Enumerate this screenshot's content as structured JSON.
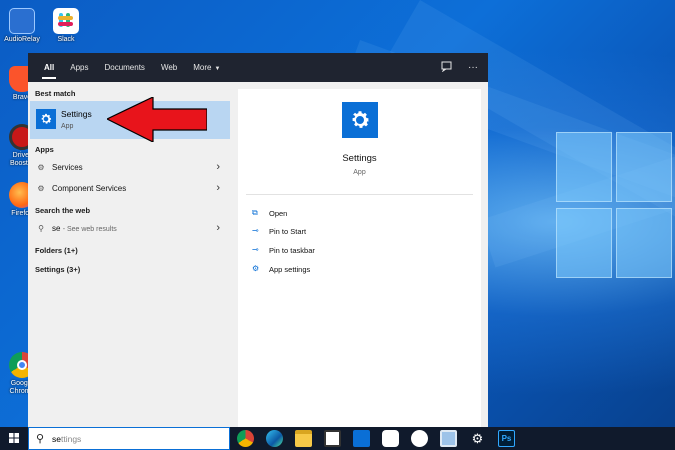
{
  "desktop": {
    "icons": [
      {
        "label": "AudioRelay"
      },
      {
        "label": "Slack"
      },
      {
        "label": "Brave"
      },
      {
        "label": "Driver Booster"
      },
      {
        "label": "Firefox"
      },
      {
        "label": "Google Chrome"
      }
    ]
  },
  "start_menu": {
    "tabs": [
      {
        "label": "All",
        "active": true
      },
      {
        "label": "Apps"
      },
      {
        "label": "Documents"
      },
      {
        "label": "Web"
      },
      {
        "label": "More"
      }
    ],
    "best_match_label": "Best match",
    "best_match": {
      "title": "Settings",
      "subtitle": "App"
    },
    "apps_label": "Apps",
    "apps": [
      {
        "label": "Services"
      },
      {
        "label": "Component Services"
      }
    ],
    "web_label": "Search the web",
    "web_result": {
      "query": "se",
      "suffix": "- See web results"
    },
    "folders_label": "Folders (1+)",
    "settings_label": "Settings (3+)",
    "detail": {
      "title": "Settings",
      "subtitle": "App",
      "actions": [
        {
          "label": "Open",
          "icon": "open-icon"
        },
        {
          "label": "Pin to Start",
          "icon": "pin-icon"
        },
        {
          "label": "Pin to taskbar",
          "icon": "pin-icon"
        },
        {
          "label": "App settings",
          "icon": "gear-icon"
        }
      ]
    }
  },
  "taskbar": {
    "search_typed": "se",
    "search_placeholder": "ttings"
  },
  "colors": {
    "accent": "#0a6fd6",
    "selection": "#b9d6f2",
    "arrow": "#e8141b",
    "taskbar": "#101a2c"
  }
}
